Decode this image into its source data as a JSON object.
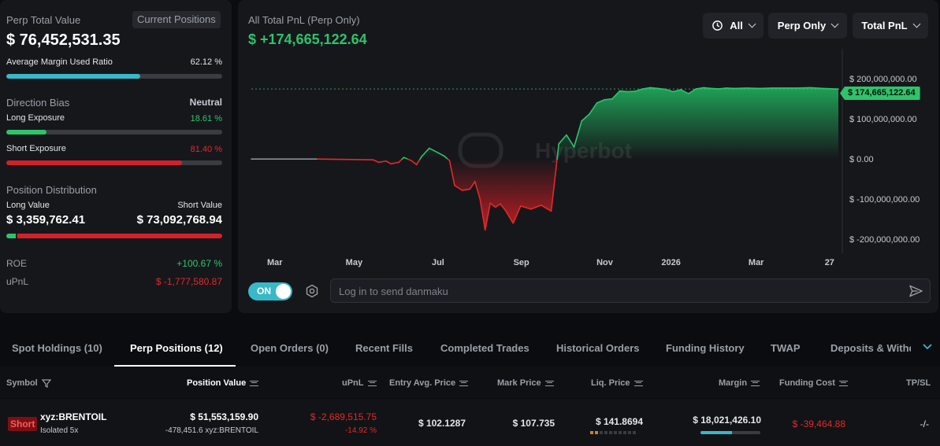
{
  "summary": {
    "perp_total_value_label": "Perp Total Value",
    "current_positions_label": "Current Positions",
    "perp_total_value": "$ 76,452,531.35",
    "avg_margin_label": "Average Margin Used Ratio",
    "avg_margin_value": "62.12 %",
    "avg_margin_fraction": 0.6212,
    "direction_bias_label": "Direction Bias",
    "direction_bias_value": "Neutral",
    "long_exposure_label": "Long Exposure",
    "long_exposure_value": "18.61 %",
    "long_exposure_fraction": 0.1861,
    "short_exposure_label": "Short Exposure",
    "short_exposure_value": "81.40 %",
    "short_exposure_fraction": 0.814,
    "position_distribution_label": "Position Distribution",
    "long_value_label": "Long Value",
    "short_value_label": "Short Value",
    "long_value": "$ 3,359,762.41",
    "short_value": "$ 73,092,768.94",
    "long_share_fraction": 0.044,
    "roe_label": "ROE",
    "roe_value": "+100.67 %",
    "upnl_label": "uPnL",
    "upnl_value": "$ -1,777,580.87"
  },
  "chart_panel": {
    "title": "All Total PnL (Perp Only)",
    "total_pnl_value": "$ +174,665,122.64",
    "filter_range": "All",
    "filter_scope": "Perp Only",
    "filter_metric": "Total PnL",
    "current_value_tag": "$ 174,665,122.64",
    "watermark": "Hyperbot",
    "danmaku_toggle": "ON",
    "danmaku_placeholder": "Log in to send danmaku"
  },
  "chart_data": {
    "type": "area",
    "title": "All Total PnL (Perp Only)",
    "xlabel": "",
    "ylabel": "",
    "x_tick_labels": [
      "Mar",
      "May",
      "Jul",
      "Sep",
      "Nov",
      "2026",
      "Mar",
      "27"
    ],
    "y_tick_labels": [
      "$ 200,000,000.00",
      "$ 100,000,000.00",
      "$ 0.00",
      "$ -100,000,000.00",
      "$ -200,000,000.00"
    ],
    "y_ticks": [
      200000000,
      100000000,
      0,
      -100000000,
      -200000000
    ],
    "ylim": [
      -235000000,
      275000000
    ],
    "reference_line": 174665122.64,
    "grid": false,
    "series": [
      {
        "x_index": [
          0,
          26,
          48,
          50,
          53,
          55,
          58,
          60,
          63,
          65,
          67,
          70,
          74,
          76,
          78,
          80,
          83,
          86,
          88,
          90,
          92,
          94,
          96,
          98,
          100,
          103,
          106,
          110,
          114,
          118,
          121,
          124,
          127,
          130,
          133,
          136,
          139,
          142,
          145,
          148,
          151,
          154,
          157,
          160,
          163,
          166,
          169,
          172,
          175,
          178,
          181,
          184,
          187,
          190,
          195,
          200,
          205,
          210,
          215,
          220,
          225,
          231
        ],
        "values": [
          0,
          0,
          -2000000,
          -8000000,
          -5000000,
          -12000000,
          -8000000,
          4000000,
          -4000000,
          -14000000,
          6000000,
          27000000,
          14000000,
          7000000,
          -4000000,
          -66000000,
          -78000000,
          -75000000,
          -56000000,
          -100000000,
          -177000000,
          -110000000,
          -120000000,
          -112000000,
          -128000000,
          -160000000,
          -117000000,
          -125000000,
          -115000000,
          -130000000,
          38000000,
          60000000,
          30000000,
          95000000,
          112000000,
          140000000,
          148000000,
          150000000,
          170000000,
          168000000,
          169000000,
          175000000,
          178000000,
          176000000,
          174000000,
          168000000,
          173000000,
          163000000,
          175000000,
          178000000,
          176000000,
          175000000,
          177000000,
          176000000,
          177000000,
          176000000,
          177000000,
          177000000,
          177000000,
          178000000,
          176000000,
          174665122.64
        ]
      }
    ]
  },
  "tabs": [
    {
      "label": "Spot Holdings (10)"
    },
    {
      "label": "Perp Positions (12)"
    },
    {
      "label": "Open Orders (0)"
    },
    {
      "label": "Recent Fills"
    },
    {
      "label": "Completed Trades"
    },
    {
      "label": "Historical Orders"
    },
    {
      "label": "Funding History"
    },
    {
      "label": "TWAP"
    },
    {
      "label": "Deposits & Withd"
    }
  ],
  "table": {
    "headers": {
      "symbol": "Symbol",
      "position_value": "Position Value",
      "upnl": "uPnL",
      "entry": "Entry Avg. Price",
      "mark": "Mark Price",
      "liq": "Liq. Price",
      "margin": "Margin",
      "funding": "Funding Cost",
      "tpsl": "TP/SL"
    },
    "rows": [
      {
        "side": "Short",
        "symbol": "xyz:BRENTOIL",
        "mode": "Isolated 5x",
        "position_value": "$ 51,553,159.90",
        "position_size": "-478,451.6 xyz:BRENTOIL",
        "upnl": "$ -2,689,515.75",
        "upnl_pct": "-14.92 %",
        "entry": "$ 102.1287",
        "mark": "$ 107.735",
        "liq": "$ 141.8694",
        "margin": "$ 18,021,426.10",
        "margin_fraction": 0.52,
        "funding": "$ -39,464.88",
        "tpsl": "-/-"
      }
    ]
  },
  "colors": {
    "green": "#2fc36b",
    "red": "#e3292b",
    "teal": "#38b8c8"
  }
}
